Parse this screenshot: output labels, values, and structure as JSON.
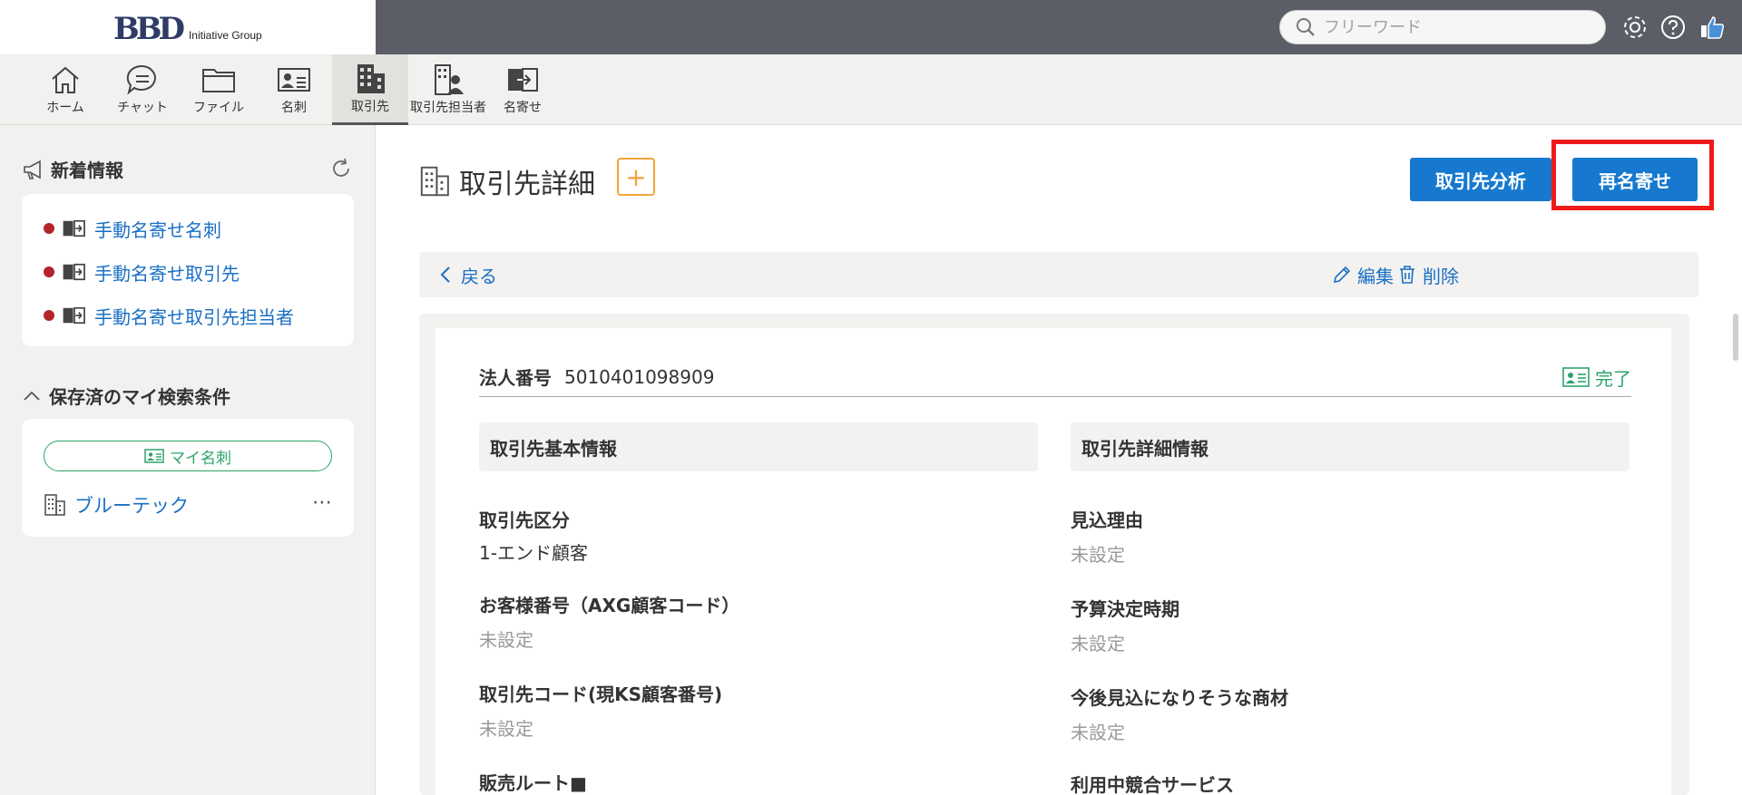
{
  "brand": {
    "logo_main": "BBD",
    "logo_sub": "Initiative Group"
  },
  "search": {
    "placeholder": "フリーワード",
    "value": ""
  },
  "nav": [
    {
      "label": "ホーム",
      "icon": "home-icon"
    },
    {
      "label": "チャット",
      "icon": "chat-icon"
    },
    {
      "label": "ファイル",
      "icon": "folder-icon"
    },
    {
      "label": "名刺",
      "icon": "business-card-icon"
    },
    {
      "label": "取引先",
      "icon": "building-icon",
      "active": true
    },
    {
      "label": "取引先担当者",
      "icon": "contact-person-icon"
    },
    {
      "label": "名寄せ",
      "icon": "merge-icon"
    }
  ],
  "sidebar": {
    "news_title": "新着情報",
    "news_items": [
      {
        "label": "手動名寄せ名刺"
      },
      {
        "label": "手動名寄せ取引先"
      },
      {
        "label": "手動名寄せ取引先担当者"
      }
    ],
    "saved_title": "保存済のマイ検索条件",
    "my_cards_label": "マイ名刺",
    "saved_items": [
      {
        "label": "ブルーテック",
        "more": "⋯"
      }
    ]
  },
  "main": {
    "title": "取引先詳細",
    "add_label": "+",
    "analyze_label": "取引先分析",
    "remerge_label": "再名寄せ",
    "back_label": "戻る",
    "edit_label": "編集",
    "delete_label": "削除",
    "corp_number_label": "法人番号",
    "corp_number_value": "5010401098909",
    "done_label": "完了",
    "left_section": {
      "title": "取引先基本情報",
      "fields": [
        {
          "label": "取引先区分",
          "value": "1-エンド顧客",
          "unset": false
        },
        {
          "label": "お客様番号（AXG顧客コード）",
          "value": "未設定",
          "unset": true
        },
        {
          "label": "取引先コード(現KS顧客番号)",
          "value": "未設定",
          "unset": true
        },
        {
          "label": "販売ルート■",
          "value": "",
          "unset": false
        }
      ]
    },
    "right_section": {
      "title": "取引先詳細情報",
      "fields": [
        {
          "label": "見込理由",
          "value": "未設定",
          "unset": true
        },
        {
          "label": "予算決定時期",
          "value": "未設定",
          "unset": true
        },
        {
          "label": "今後見込になりそうな商材",
          "value": "未設定",
          "unset": true
        },
        {
          "label": "利用中競合サービス",
          "value": "",
          "unset": false
        }
      ]
    }
  },
  "colors": {
    "accent_blue": "#1679cf",
    "link_blue": "#1a6fc4",
    "highlight_red": "#ee1b1b",
    "success_green": "#2fa36b",
    "add_orange": "#f3a43a",
    "topbar": "#5b5e66"
  }
}
